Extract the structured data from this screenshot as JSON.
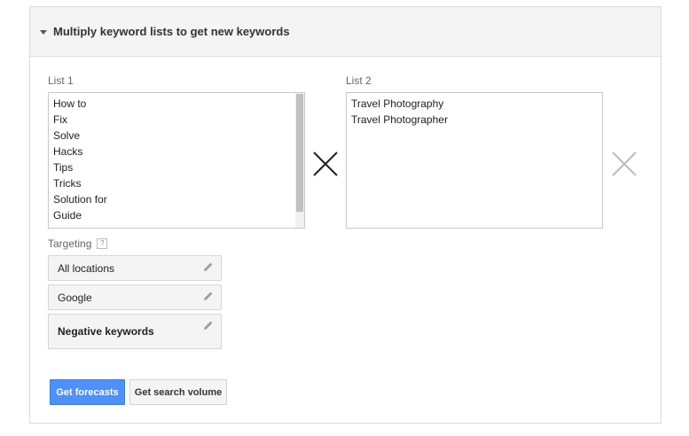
{
  "panel": {
    "title": "Multiply keyword lists to get new keywords"
  },
  "list1": {
    "label": "List 1",
    "items": [
      "How to",
      "Fix",
      "Solve",
      "Hacks",
      "Tips",
      "Tricks",
      "Solution for",
      "Guide"
    ]
  },
  "list2": {
    "label": "List 2",
    "items": [
      "Travel Photography",
      "Travel Photographer"
    ]
  },
  "targeting": {
    "label": "Targeting",
    "help": "?",
    "locations": "All locations",
    "network": "Google",
    "negative": "Negative keywords"
  },
  "actions": {
    "forecasts": "Get forecasts",
    "search_volume": "Get search volume"
  },
  "colors": {
    "primary": "#4d90fe",
    "header_bg": "#f4f4f4"
  }
}
